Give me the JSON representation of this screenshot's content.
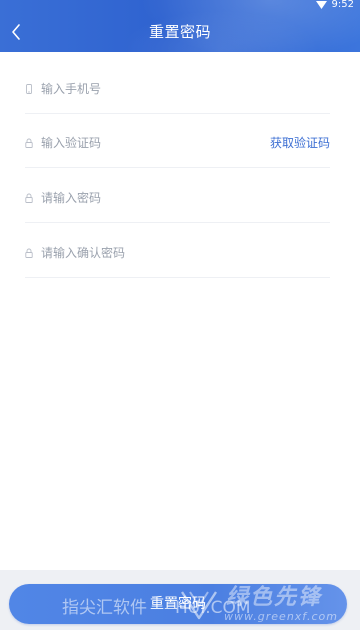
{
  "status_bar": {
    "time": "9:52",
    "wifi_icon": "wifi-icon"
  },
  "header": {
    "title": "重置密码",
    "back_icon": "chevron-left-icon",
    "background_color": "#3467d3"
  },
  "form": {
    "phone": {
      "placeholder": "输入手机号",
      "value": "",
      "icon": "phone-icon"
    },
    "code": {
      "placeholder": "输入验证码",
      "value": "",
      "icon": "lock-icon",
      "get_code_label": "获取验证码"
    },
    "password": {
      "placeholder": "请输入密码",
      "value": "",
      "icon": "lock-icon"
    },
    "confirm_password": {
      "placeholder": "请输入确认密码",
      "value": "",
      "icon": "lock-icon"
    }
  },
  "submit": {
    "label": "重置密码",
    "color": "#4d82e3"
  },
  "colors": {
    "accent": "#3d6fd3",
    "placeholder": "#9aa1ad",
    "divider": "#eef0f4"
  },
  "watermark": {
    "left_text": "指尖汇软件",
    "right_text": "绿色先锋",
    "partial_text": "HUI.COM",
    "url": "www.greenxf.com"
  }
}
